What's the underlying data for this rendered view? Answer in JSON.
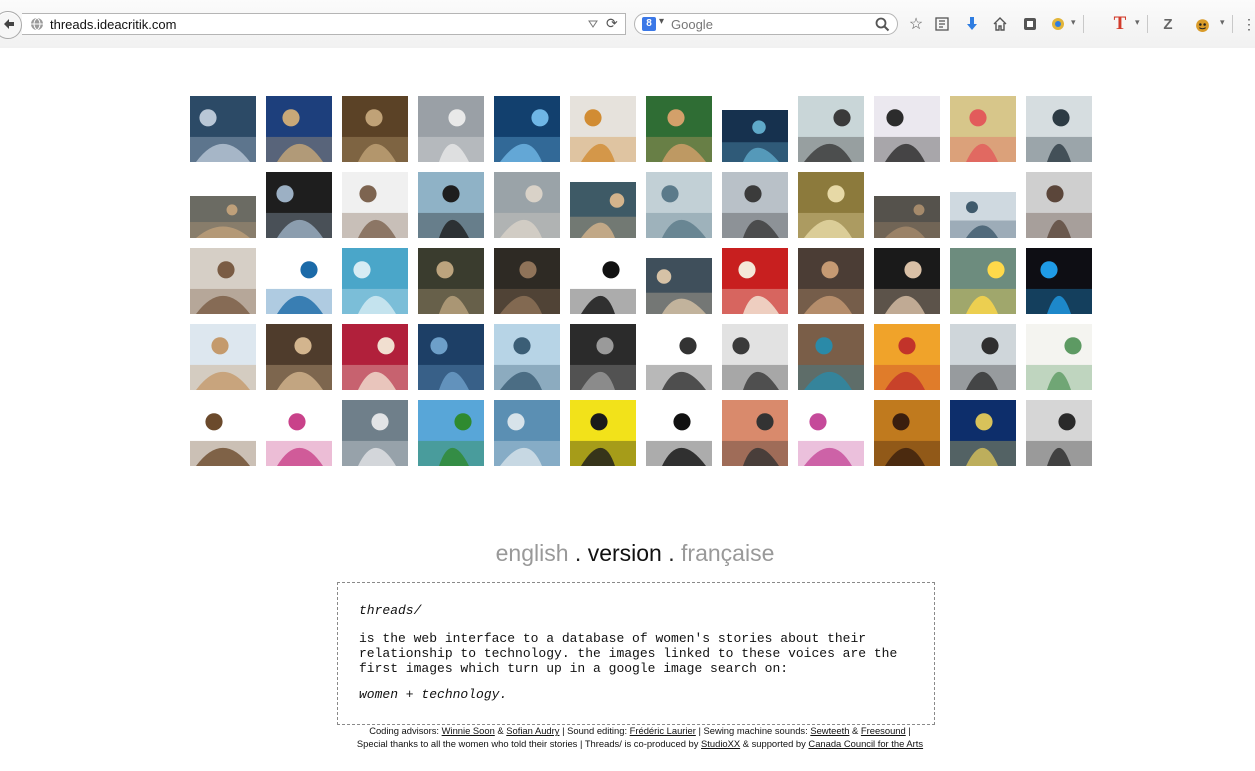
{
  "browser": {
    "url": "threads.ideacritik.com",
    "search_engine": "Google",
    "search_badge": "8",
    "toolbar_letter_t": "T",
    "toolbar_letter_z": "Z"
  },
  "gallery": {
    "rows": 5,
    "columns": 12,
    "thumbs": [
      {
        "bg": "#2c4a66",
        "fg": "#b9c7d6"
      },
      {
        "bg": "#1d3f7c",
        "fg": "#c8a878"
      },
      {
        "bg": "#5b4226",
        "fg": "#c0a277"
      },
      {
        "bg": "#9aa0a6",
        "fg": "#e9e9e9"
      },
      {
        "bg": "#12406e",
        "fg": "#6fb6e6"
      },
      {
        "bg": "#e6e2dc",
        "fg": "#d18c33"
      },
      {
        "bg": "#2f6d34",
        "fg": "#d3a06a"
      },
      {
        "bg": "#16314e",
        "fg": "#5fa9c9"
      },
      {
        "bg": "#c9d6d8",
        "fg": "#3a3a3a"
      },
      {
        "bg": "#ebe8ef",
        "fg": "#2c2c2c"
      },
      {
        "bg": "#d7c68a",
        "fg": "#e25b5b"
      },
      {
        "bg": "#d6dde0",
        "fg": "#2d3b44"
      },
      {
        "bg": "#6b6b63",
        "fg": "#bfa07a"
      },
      {
        "bg": "#1e1e1e",
        "fg": "#9cb0c4"
      },
      {
        "bg": "#f0f0f0",
        "fg": "#7d6450"
      },
      {
        "bg": "#8fb2c6",
        "fg": "#1e1e1e"
      },
      {
        "bg": "#9aa3a8",
        "fg": "#d9d2c8"
      },
      {
        "bg": "#3e5a66",
        "fg": "#d4b48c"
      },
      {
        "bg": "#c2d0d6",
        "fg": "#5b7a8a"
      },
      {
        "bg": "#b9c1c8",
        "fg": "#3b3b3b"
      },
      {
        "bg": "#8c7a3c",
        "fg": "#e7d9a6"
      },
      {
        "bg": "#55524c",
        "fg": "#a58a6b"
      },
      {
        "bg": "#cfd9e0",
        "fg": "#3f5a6c"
      },
      {
        "bg": "#cfcfcf",
        "fg": "#5b463a"
      },
      {
        "bg": "#d6cfc6",
        "fg": "#7a5c44"
      },
      {
        "bg": "#ffffff",
        "fg": "#1b6aa8"
      },
      {
        "bg": "#4aa6c9",
        "fg": "#d7ecf4"
      },
      {
        "bg": "#3a3c2e",
        "fg": "#bca47e"
      },
      {
        "bg": "#2e2a24",
        "fg": "#8f7359"
      },
      {
        "bg": "#ffffff",
        "fg": "#111111"
      },
      {
        "bg": "#3f4f5b",
        "fg": "#d6c2a6"
      },
      {
        "bg": "#c81f1f",
        "fg": "#f4e8d8"
      },
      {
        "bg": "#4b3d35",
        "fg": "#c59a73"
      },
      {
        "bg": "#1a1a1a",
        "fg": "#d9c0a6"
      },
      {
        "bg": "#6d8c7e",
        "fg": "#ffd94a"
      },
      {
        "bg": "#0e0e14",
        "fg": "#1f9be6"
      },
      {
        "bg": "#dde7ef",
        "fg": "#c49a6c"
      },
      {
        "bg": "#4f3c2c",
        "fg": "#d3b58e"
      },
      {
        "bg": "#b1203b",
        "fg": "#f1dfd0"
      },
      {
        "bg": "#1d3f66",
        "fg": "#6d9fc9"
      },
      {
        "bg": "#b7d4e6",
        "fg": "#3b5e76"
      },
      {
        "bg": "#2b2b2b",
        "fg": "#9a9a9a"
      },
      {
        "bg": "#ffffff",
        "fg": "#333333"
      },
      {
        "bg": "#e2e2e2",
        "fg": "#3a3a3a"
      },
      {
        "bg": "#7a5e48",
        "fg": "#2a8aa8"
      },
      {
        "bg": "#f0a32a",
        "fg": "#c2332a"
      },
      {
        "bg": "#cfd6da",
        "fg": "#2f2f2f"
      },
      {
        "bg": "#f4f4f0",
        "fg": "#5d9a63"
      },
      {
        "bg": "#ffffff",
        "fg": "#6b4a2c"
      },
      {
        "bg": "#ffffff",
        "fg": "#c9428a"
      },
      {
        "bg": "#6f7f8a",
        "fg": "#e2e4e6"
      },
      {
        "bg": "#58a6d8",
        "fg": "#2f8a2f"
      },
      {
        "bg": "#5b8fb3",
        "fg": "#d7e3ea"
      },
      {
        "bg": "#f2e21a",
        "fg": "#1a1a1a"
      },
      {
        "bg": "#ffffff",
        "fg": "#111111"
      },
      {
        "bg": "#d98a6c",
        "fg": "#333333"
      },
      {
        "bg": "#ffffff",
        "fg": "#c54a9a"
      },
      {
        "bg": "#c07a1e",
        "fg": "#3a1e0e"
      },
      {
        "bg": "#0d2e6b",
        "fg": "#d8c25a"
      },
      {
        "bg": "#d6d6d6",
        "fg": "#2a2a2a"
      }
    ]
  },
  "language": {
    "english": "english",
    "separator": ".",
    "version": "version",
    "francaise": "française"
  },
  "about": {
    "title": "threads/",
    "body": "is the web interface to a database of women's stories about their\nrelationship to technology. the images linked to these voices are the\nfirst images which turn up in a google image search on:",
    "query": "women + technology."
  },
  "credits": {
    "coding_label": "Coding advisors:",
    "coder_1": "Winnie Soon",
    "amp": "&",
    "coder_2": "Sofian Audry",
    "sound_label": "| Sound editing:",
    "sound_editor": "Frédéric Laurier",
    "sewing_label": "| Sewing machine sounds:",
    "sewing_1": "Sewteeth",
    "sewing_2": "Freesound",
    "end_bar": "|",
    "thanks": "Special thanks to all the women who told their stories | Threads/ is co-produced by",
    "coproducer": "StudioXX",
    "supported": "& supported by",
    "supporter": "Canada Council for the Arts"
  },
  "colors": {
    "link": "#111111",
    "lang_inactive": "#999999",
    "lang_active": "#111111",
    "panel_border": "#8a8a8a"
  }
}
